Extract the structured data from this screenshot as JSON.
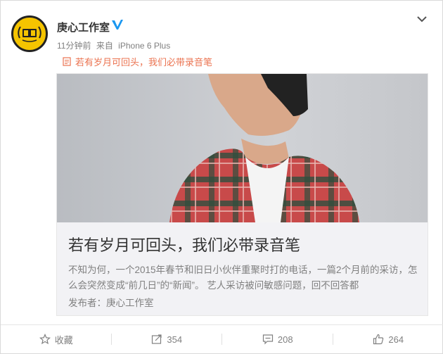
{
  "post": {
    "author": "庚心工作室",
    "time": "11分钟前",
    "via": "来自",
    "source": "iPhone 6 Plus",
    "link_text": "若有岁月可回头，我们必带录音笔"
  },
  "article": {
    "title": "若有岁月可回头，我们必带录音笔",
    "description": "不知为何，一个2015年春节和旧日小伙伴重聚时打的电话，一篇2个月前的采访，怎么会突然变成“前几日”的“新闻”。 艺人采访被问敏感问题，回不回答都",
    "publisher": "发布者：庚心工作室"
  },
  "actions": {
    "favorite": "收藏",
    "repost": "354",
    "comment": "208",
    "like": "264"
  },
  "colors": {
    "link": "#eb7350",
    "verified": "#1a97f0",
    "avatar_bg": "#f5c400"
  }
}
